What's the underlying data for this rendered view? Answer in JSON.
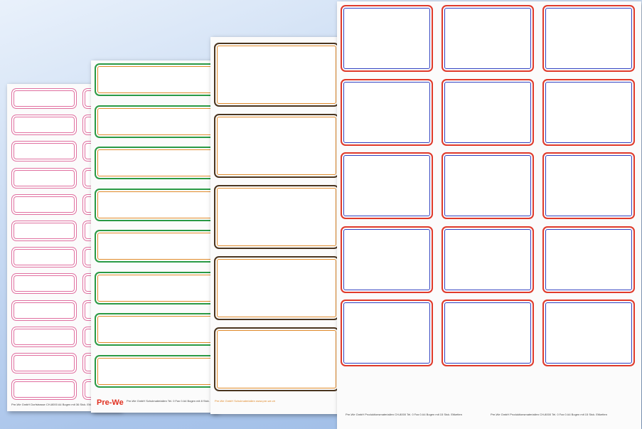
{
  "scene": "Four sheets of self-adhesive school labels fanned out on a blue gradient background",
  "colors": {
    "background_top": "#e9f1fb",
    "background_bottom": "#9bbbe6",
    "pink_border": "#e070a0",
    "green_border": "#2a9a45",
    "orange_border": "#e08a2a",
    "brown_border": "#4a3520",
    "red_border": "#e03a2a",
    "blue_border": "#3040c0"
  },
  "sheets": [
    {
      "name": "pink-label-sheet",
      "footer": "Pre-We GmbH  Dorfstrasse  CH-8000  A4 Bogen mit 36 Stck. Etiketten"
    },
    {
      "name": "green-label-sheet",
      "brand": "Pre-We",
      "footer": "Pre-We GmbH  Schulmaterialien  Tel. 0 Fax 0  A4 Bogen mit 8 Stck. Etiketten"
    },
    {
      "name": "brown-label-sheet",
      "footer": "Pre-We GmbH  Schulmaterialien  www.pre-we.ch"
    },
    {
      "name": "blue-red-label-sheet",
      "footer_left": "Pre-We GmbH  Produktionsmaterialien  CH-8000  Tel. 0  Fax 0  A4 Bogen mit 15 Stck. Etiketten",
      "footer_right": "Pre-We GmbH  Produktionsmaterialien  CH-8000  Tel. 0  Fax 0  A4 Bogen mit 15 Stck. Etiketten"
    }
  ]
}
